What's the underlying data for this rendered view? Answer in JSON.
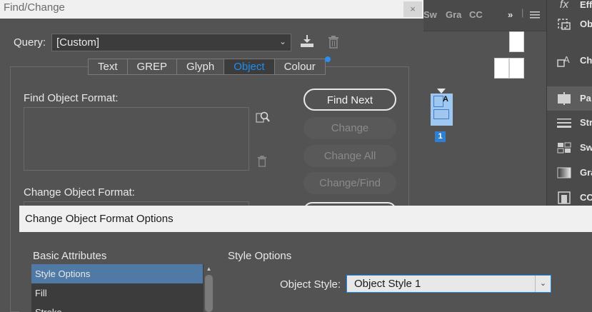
{
  "find_change": {
    "title": "Find/Change",
    "close_glyph": "×",
    "query_label": "Query:",
    "query_value": "[Custom]",
    "tabs": [
      {
        "label": "Text",
        "active": false
      },
      {
        "label": "GREP",
        "active": false
      },
      {
        "label": "Glyph",
        "active": false
      },
      {
        "label": "Object",
        "active": true
      },
      {
        "label": "Colour",
        "active": false
      }
    ],
    "find_label": "Find Object Format:",
    "change_label": "Change Object Format:",
    "buttons": {
      "find_next": "Find Next",
      "change": "Change",
      "change_all": "Change All",
      "change_find": "Change/Find"
    }
  },
  "panel_tabs": [
    "Sw",
    "Gra",
    "CC"
  ],
  "panel_tab_overflow": "»",
  "pages_panel": {
    "page_number": "1",
    "master_prefix": "A"
  },
  "right_dock": [
    {
      "icon": "effects-icon",
      "label": "Eff"
    },
    {
      "icon": "object-styles-icon",
      "label": "Ob"
    },
    {
      "icon": "character-styles-icon",
      "label": "Ch"
    },
    {
      "icon": "pages-icon",
      "label": "Pa",
      "active": true
    },
    {
      "icon": "stroke-icon",
      "label": "Str"
    },
    {
      "icon": "swatches-icon",
      "label": "Sw"
    },
    {
      "icon": "gradient-icon",
      "label": "Gra"
    },
    {
      "icon": "cc-libraries-icon",
      "label": "CC"
    }
  ],
  "change_object_format_options": {
    "title": "Change Object Format Options",
    "list_label": "Basic Attributes",
    "items": [
      "Style Options",
      "Fill",
      "Stroke"
    ],
    "selected_item": "Style Options",
    "section_title": "Style Options",
    "object_style_label": "Object Style:",
    "object_style_value": "Object Style 1"
  },
  "colors": {
    "accent": "#1e8cf0",
    "dialog_bg": "#535353",
    "selection": "#4e7aa5"
  }
}
